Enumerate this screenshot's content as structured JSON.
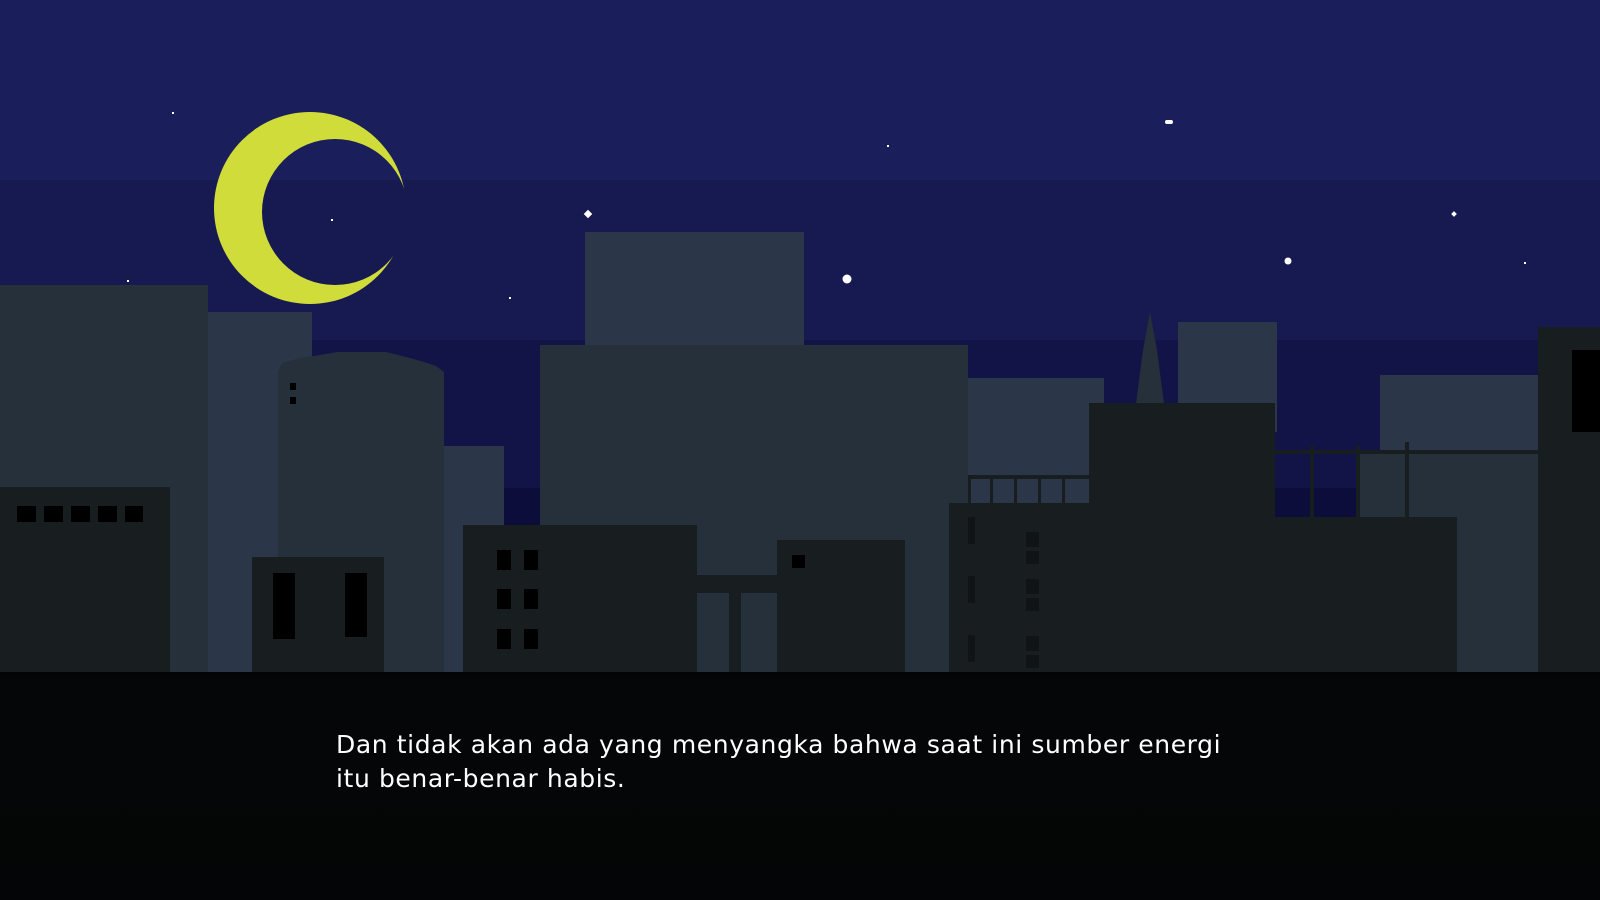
{
  "colors": {
    "sky_top": "#1a1e5a",
    "sky_mid": "#161a50",
    "sky_low": "#121447",
    "sky_horizon": "#0d0d3b",
    "moon": "#cfdc3a",
    "star": "#ffffff",
    "building_far": "#2b3749",
    "building_mid": "#26303a",
    "building_near": "#181d20",
    "window": "#000000"
  },
  "icons": {
    "moon": "crescent-moon-icon",
    "star": "star-icon"
  },
  "dialogue": {
    "text": "Dan tidak akan ada yang menyangka bahwa saat ini sumber energi\nitu benar-benar habis."
  }
}
